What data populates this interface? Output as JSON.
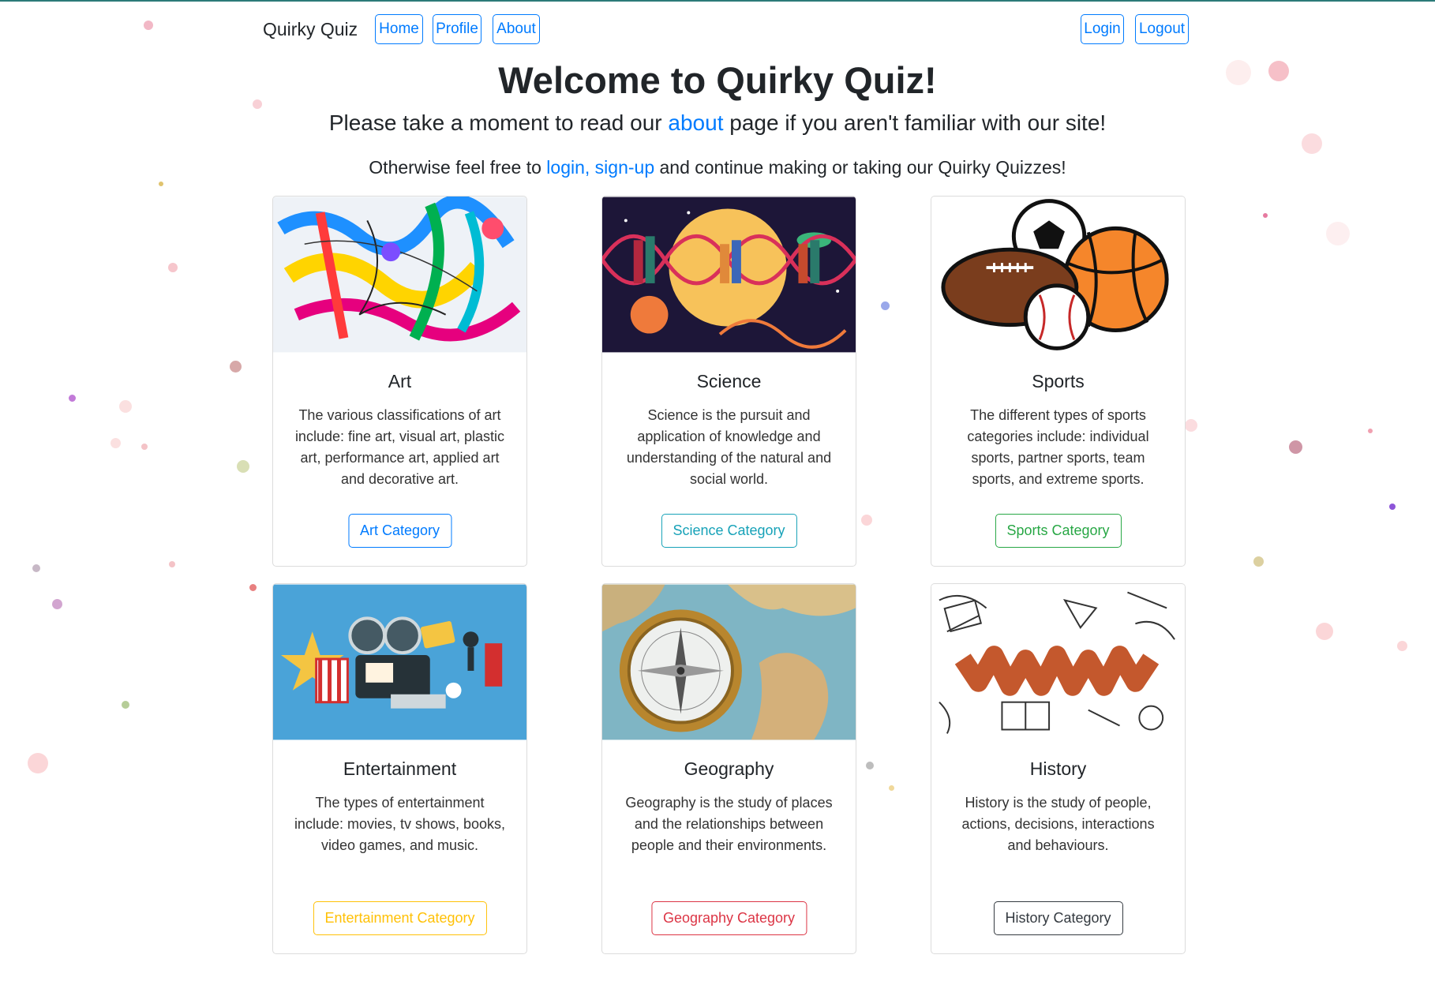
{
  "nav": {
    "brand": "Quirky Quiz",
    "home": "Home",
    "profile": "Profile",
    "about": "About",
    "login": "Login",
    "logout": "Logout"
  },
  "hero": {
    "title": "Welcome to Quirky Quiz!",
    "sub_before": "Please take a moment to read our ",
    "sub_link": "about",
    "sub_after": " page if you aren't familiar with our site!",
    "sub2_before": "Otherwise feel free to ",
    "sub2_link": "login, sign-up",
    "sub2_after": " and continue making or taking our Quirky Quizzes!"
  },
  "cards": [
    {
      "title": "Art",
      "text": "The various classifications of art include: fine art, visual art, plastic art, performance art, applied art and decorative art.",
      "button": "Art Category",
      "button_color": "#007bff",
      "image": "paint-splash-image"
    },
    {
      "title": "Science",
      "text": "Science is the pursuit and application of knowledge and understanding of the natural and social world.",
      "button": "Science Category",
      "button_color": "#17a2b8",
      "image": "dna-books-image"
    },
    {
      "title": "Sports",
      "text": "The different types of sports categories include: individual sports, partner sports, team sports, and extreme sports.",
      "button": "Sports Category",
      "button_color": "#28a745",
      "image": "sports-balls-image"
    },
    {
      "title": "Entertainment",
      "text": "The types of entertainment include: movies, tv shows, books, video games, and music.",
      "button": "Entertainment Category",
      "button_color": "#ffc107",
      "image": "cinema-items-image"
    },
    {
      "title": "Geography",
      "text": "Geography is the study of places and the relationships between people and their environments.",
      "button": "Geography Category",
      "button_color": "#dc3545",
      "image": "compass-map-image"
    },
    {
      "title": "History",
      "text": "History is the study of people, actions, decisions, interactions and behaviours.",
      "button": "History Category",
      "button_color": "#343a40",
      "image": "history-doodle-image"
    }
  ]
}
